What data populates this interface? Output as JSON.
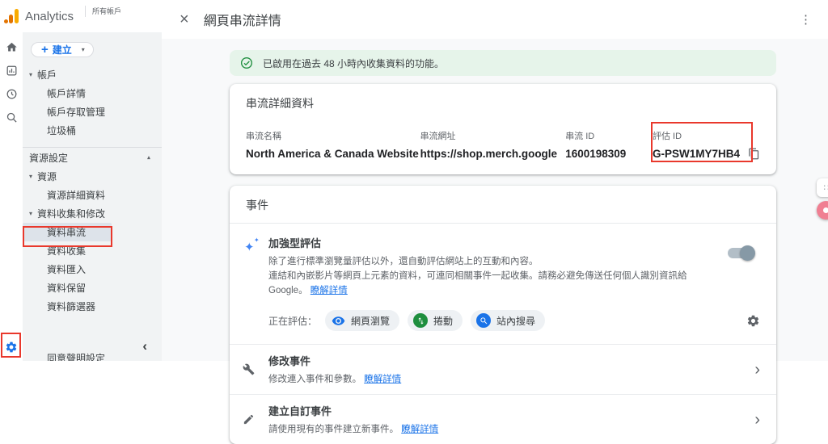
{
  "colors": {
    "accent_blue": "#1a73e8",
    "green": "#1e8e3e",
    "banner_bg": "#e6f4ea",
    "annotation_red": "#e9382c",
    "selected_item_bg": "#dde3ea"
  },
  "sidebar": {
    "brand": "Analytics",
    "account_switcher": "所有帳戶",
    "create_button": {
      "label": "建立"
    },
    "groups": {
      "account": {
        "label": "帳戶",
        "items": [
          {
            "label": "帳戶詳情"
          },
          {
            "label": "帳戶存取管理"
          },
          {
            "label": "垃圾桶"
          }
        ]
      },
      "settings_header": "資源設定",
      "property": {
        "label": "資源",
        "items": [
          {
            "label": "資源詳細資料"
          }
        ]
      },
      "data": {
        "label": "資料收集和修改",
        "items": [
          {
            "label": "資料串流",
            "selected": true
          },
          {
            "label": "資料收集"
          },
          {
            "label": "資料匯入"
          },
          {
            "label": "資料保留"
          },
          {
            "label": "資料篩選器"
          },
          {
            "label": "同意聲明設定"
          }
        ]
      }
    }
  },
  "header": {
    "title": "網頁串流詳情"
  },
  "banner": {
    "text": "已啟用在過去 48 小時內收集資料的功能。"
  },
  "stream_details": {
    "title": "串流詳細資料",
    "fields": [
      {
        "label": "串流名稱",
        "value": "North America & Canada Website"
      },
      {
        "label": "串流網址",
        "value": "https://shop.merch.google"
      },
      {
        "label": "串流 ID",
        "value": "1600198309"
      },
      {
        "label": "評估 ID",
        "value": "G-PSW1MY7HB4"
      }
    ]
  },
  "events": {
    "title": "事件",
    "enhanced": {
      "title": "加強型評估",
      "description_line1": "除了進行標準瀏覽量評估以外，還自動評估網站上的互動和內容。",
      "description_line2": "連結和內嵌影片等網頁上元素的資料，可連同相關事件一起收集。請務必避免傳送任何個人識別資訊給 Google。",
      "learn_more": "瞭解詳情",
      "toggle_on": true,
      "measuring_label": "正在評估：",
      "chips": [
        {
          "label": "網頁瀏覽"
        },
        {
          "label": "捲動"
        },
        {
          "label": "站內搜尋"
        }
      ]
    },
    "rows": [
      {
        "title": "修改事件",
        "description": "修改連入事件和參數。",
        "link": "瞭解詳情"
      },
      {
        "title": "建立自訂事件",
        "description": "請使用現有的事件建立新事件。",
        "link": "瞭解詳情"
      }
    ]
  }
}
